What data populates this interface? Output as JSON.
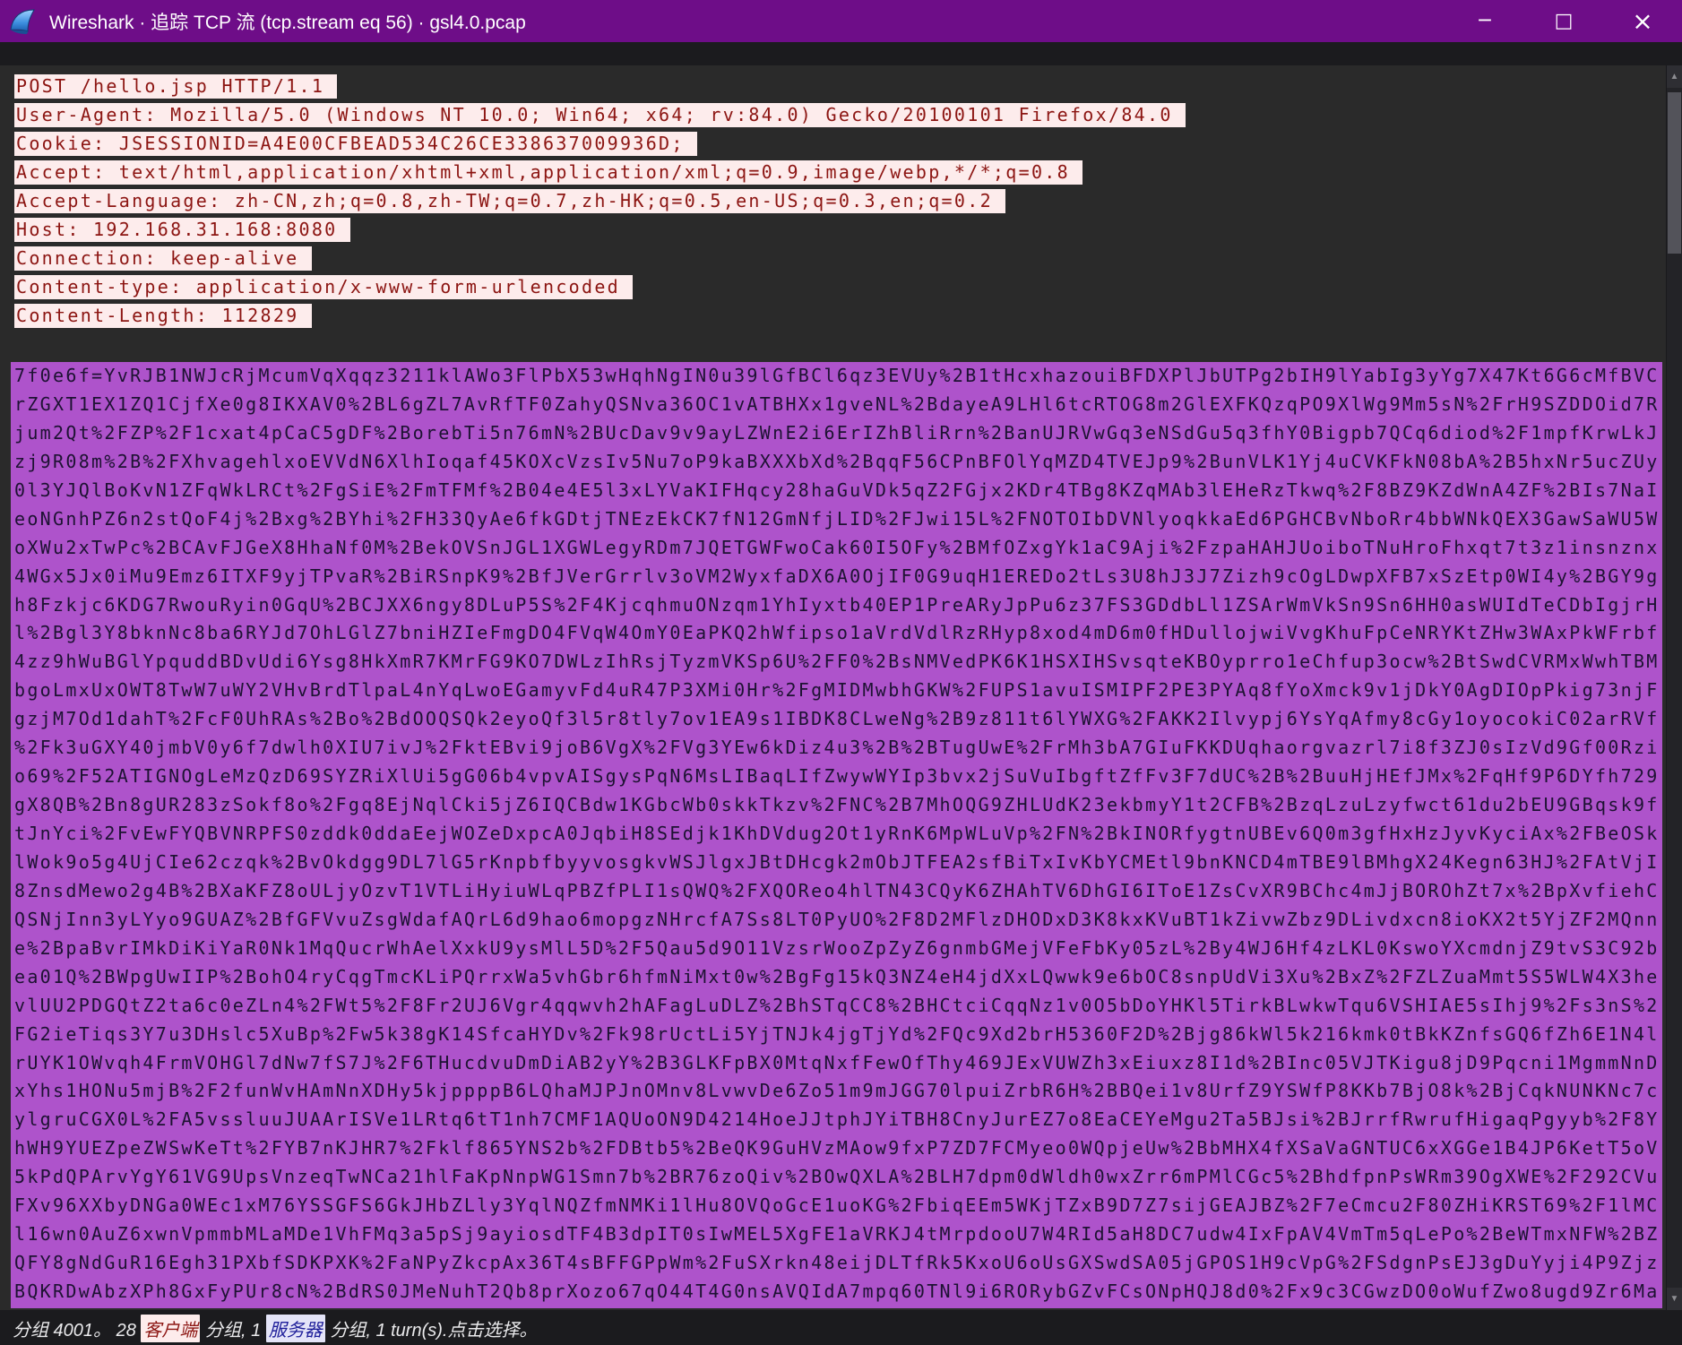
{
  "window": {
    "title": "Wireshark · 追踪 TCP 流 (tcp.stream eq 56) · gsl4.0.pcap",
    "minimize_glyph": "─",
    "maximize_glyph": "□",
    "close_glyph": "×"
  },
  "colors": {
    "titlebar": "#6e0d88",
    "pane_background": "#2a2a2a",
    "dialog_background": "#1b1b1e",
    "client_text": "#8c1512",
    "client_highlight": "#fdecec",
    "selection_highlight": "#ae53cb",
    "selection_text": "#1e1233",
    "server_badge_text": "#1d1d99",
    "server_badge_bg": "#e4e4f8"
  },
  "scrollbar": {
    "up_glyph": "▲",
    "down_glyph": "▼"
  },
  "stream": {
    "request_header_lines": [
      "POST /hello.jsp HTTP/1.1",
      "User-Agent: Mozilla/5.0 (Windows NT 10.0; Win64; x64; rv:84.0) Gecko/20100101 Firefox/84.0",
      "Cookie: JSESSIONID=A4E00CFBEAD534C26CE338637009936D;",
      "Accept: text/html,application/xhtml+xml,application/xml;q=0.9,image/webp,*/*;q=0.8",
      "Accept-Language: zh-CN,zh;q=0.8,zh-TW;q=0.7,zh-HK;q=0.5,en-US;q=0.3,en;q=0.2",
      "Host: 192.168.31.168:8080",
      "Connection: keep-alive",
      "Content-type: application/x-www-form-urlencoded",
      "Content-Length: 112829"
    ],
    "body_lines": [
      "7f0e6f=YvRJB1NWJcRjMcumVqXqqz3211klAWo3FlPbX53wHqhNgIN0u39lGfBCl6qz3EVUy%2B1tHcxhazouiBFDXPlJbUTPg2bIH9lYabIg3yYg7X47Kt6G6cMfBVC",
      "rZGXT1EX1ZQ1CjfXe0g8IKXAV0%2BL6gZL7AvRfTF0ZahyQSNva36OC1vATBHXx1gveNL%2BdayeA9LHl6tcRTOG8m2GlEXFKQzqPO9XlWg9Mm5sN%2FrH9SZDDOid7R",
      "jum2Qt%2FZP%2F1cxat4pCaC5gDF%2BorebTi5n76mN%2BUcDav9v9ayLZWnE2i6ErIZhBliRrn%2BanUJRVwGq3eNSdGu5q3fhY0Bigpb7QCq6diod%2F1mpfKrwLkJ",
      "zj9R08m%2B%2FXhvagehlxoEVVdN6XlhIoqaf45KOXcVzsIv5Nu7oP9kaBXXXbXd%2BqqF56CPnBFOlYqMZD4TVEJp9%2BunVLK1Yj4uCVKFkN08bA%2B5hxNr5ucZUy",
      "0l3YJQlBoKvN1ZFqWkLRCt%2FgSiE%2FmTFMf%2B04e4E5l3xLYVaKIFHqcy28haGuVDk5qZ2FGjx2KDr4TBg8KZqMAb3lEHeRzTkwq%2F8BZ9KZdWnA4ZF%2BIs7NaI",
      "eoNGnhPZ6n2stQoF4j%2Bxg%2BYhi%2FH33QyAe6fkGDtjTNEzEkCK7fN12GmNfjLID%2FJwi15L%2FNOTOIbDVNlyoqkkaEd6PGHCBvNboRr4bbWNkQEX3GawSaWU5W",
      "oXWu2xTwPc%2BCAvFJGeX8HhaNf0M%2BekOVSnJGL1XGWLegyRDm7JQETGWFwoCak60I5OFy%2BMfOZxgYk1aC9Aji%2FzpaHAHJUoiboTNuHroFhxqt7t3z1insnznx",
      "4WGx5Jx0iMu9Emz6ITXF9yjTPvaR%2BiRSnpK9%2BfJVerGrrlv3oVM2WyxfaDX6A0OjIF0G9uqH1EREDo2tLs3U8hJ3J7Zizh9cOgLDwpXFB7xSzEtp0WI4y%2BGY9g",
      "h8Fzkjc6KDG7RwouRyin0GqU%2BCJXX6ngy8DLuP5S%2F4KjcqhmuONzqm1YhIyxtb40EP1PreARyJpPu6z37FS3GDdbLl1ZSArWmVkSn9Sn6HH0asWUIdTeCDbIgjrH",
      "l%2Bgl3Y8bknNc8ba6RYJd7OhLGlZ7bniHZIeFmgDO4FVqW4OmY0EaPKQ2hWfipso1aVrdVdlRzRHyp8xod4mD6m0fHDullojwiVvgKhuFpCeNRYKtZHw3WAxPkWFrbf",
      "4zz9hWuBGlYpquddBDvUdi6Ysg8HkXmR7KMrFG9KO7DWLzIhRsjTyzmVKSp6U%2FF0%2BsNMVedPK6K1HSXIHSvsqteKBOyprro1eChfup3ocw%2BtSwdCVRMxWwhTBM",
      "bgoLmxUxOWT8TwW7uWY2VHvBrdTlpaL4nYqLwoEGamyvFd4uR47P3XMi0Hr%2FgMIDMwbhGKW%2FUPS1avuISMIPF2PE3PYAq8fYoXmck9v1jDkY0AgDIOpPkig73njF",
      "gzjM7Od1dahT%2FcF0UhRAs%2Bo%2BdOOQSQk2eyoQf3l5r8tly7ov1EA9s1IBDK8CLweNg%2B9z811t6lYWXG%2FAKK2Ilvypj6YsYqAfmy8cGy1oyocokiC02arRVf",
      "%2Fk3uGXY40jmbV0y6f7dwlh0XIU7ivJ%2FktEBvi9joB6VgX%2FVg3YEw6kDiz4u3%2B%2BTugUwE%2FrMh3bA7GIuFKKDUqhaorgvazrl7i8f3ZJ0sIzVd9Gf00Rzi",
      "o69%2F52ATIGNOgLeMzQzD69SYZRiXlUi5gG06b4vpvAISgysPqN6MsLIBaqLIfZwywWYIp3bvx2jSuVuIbgftZfFv3F7dUC%2B%2BuuHjHEfJMx%2FqHf9P6DYfh729",
      "gX8QB%2Bn8gUR283zSokf8o%2Fgq8EjNqlCki5jZ6IQCBdw1KGbcWb0skkTkzv%2FNC%2B7MhOQG9ZHLUdK23ekbmyY1t2CFB%2BzqLzuLzyfwct61du2bEU9GBqsk9f",
      "tJnYci%2FvEwFYQBVNRPFS0zddk0ddaEejWOZeDxpcA0JqbiH8SEdjk1KhDVdug2Ot1yRnK6MpWLuVp%2FN%2BkINORfygtnUBEv6Q0m3gfHxHzJyvKyciAx%2FBeOSk",
      "lWok9o5g4UjCIe62czqk%2BvOkdgg9DL7lG5rKnpbfbyyvosgkvWSJlgxJBtDHcgk2mObJTFEA2sfBiTxIvKbYCMEtl9bnKNCD4mTBE9lBMhgX24Kegn63HJ%2FAtVjI",
      "8ZnsdMewo2g4B%2BXaKFZ8oULjyOzvT1VTLiHyiuWLqPBZfPLI1sQWQ%2FXQOReo4hlTN43CQyK6ZHAhTV6DhGI6IToE1ZsCvXR9BChc4mJjBOROhZt7x%2BpXvfiehC",
      "QSNjInn3yLYyo9GUAZ%2BfGFVvuZsgWdafAQrL6d9hao6mopgzNHrcfA7Ss8LT0PyUO%2F8D2MFlzDHODxD3K8kxKVuBT1kZivwZbz9DLivdxcn8ioKX2t5YjZF2MQnn",
      "e%2BpaBvrIMkDiKiYaR0Nk1MqQucrWhAelXxkU9ysMlL5D%2F5Qau5d9O11VzsrWooZpZyZ6gnmbGMejVFeFbKy05zL%2By4WJ6Hf4zLKL0KswoYXcmdnjZ9tvS3C92b",
      "ea01Q%2BWpgUwIIP%2BohO4ryCqgTmcKLiPQrrxWa5vhGbr6hfmNiMxt0w%2BgFg15kQ3NZ4eH4jdXxLQwwk9e6bOC8snpUdVi3Xu%2BxZ%2FZLZuaMmt5S5WLW4X3he",
      "vlUU2PDGQtZ2ta6c0eZLn4%2FWt5%2F8Fr2UJ6Vgr4qqwvh2hAFagLuDLZ%2BhSTqCC8%2BHCtciCqqNz1v0O5bDoYHKl5TirkBLwkwTqu6VSHIAE5sIhj9%2Fs3nS%2",
      "FG2ieTiqs3Y7u3DHslc5XuBp%2Fw5k38gK14SfcaHYDv%2Fk98rUctLi5YjTNJk4jgTjYd%2FQc9Xd2brH5360F2D%2Bjg86kWl5k216kmk0tBkKZnfsGQ6fZh6E1N4l",
      "rUYK1OWvqh4FrmVOHGl7dNw7fS7J%2F6THucdvuDmDiAB2yY%2B3GLKFpBX0MtqNxfFewOfThy469JExVUWZh3xEiuxz8I1d%2BInc05VJTKigu8jD9Pqcni1MgmmNnD",
      "xYhs1HONu5mjB%2F2funWvHAmNnXDHy5kjppppB6LQhaMJPJnOMnv8LvwvDe6Zo51m9mJGG70lpuiZrbR6H%2BBQei1v8UrfZ9YSWfP8KKb7BjO8k%2BjCqkNUNKNc7c",
      "ylgruCGX0L%2FA5vssluuJUAArISVe1LRtq6tT1nh7CMF1AQUoON9D4214HoeJJtphJYiTBH8CnyJurEZ7o8EaCEYeMgu2Ta5BJsi%2BJrrfRwrufHigaqPgyyb%2F8Y",
      "hWH9YUEZpeZWSwKeTt%2FYB7nKJHR7%2Fklf865YNS2b%2FDBtb5%2BeQK9GuHVzMAow9fxP7ZD7FCMyeo0WQpjeUw%2BbMHX4fXSaVaGNTUC6xXGGe1B4JP6KetT5oV",
      "5kPdQPArvYgY61VG9UpsVnzeqTwNCa21hlFaKpNnpWG1Smn7b%2BR76zoQiv%2BOwQXLA%2BLH7dpm0dWldh0wxZrr6mPMlCGc5%2BhdfpnPsWRm39OgXWE%2F292CVu",
      "FXv96XXbyDNGa0WEc1xM76YSSGFS6GkJHbZLly3YqlNQZfmNMKi1lHu8OVQoGcE1uoKG%2FbiqEEm5WKjTZxB9D7Z7sijGEAJBZ%2F7eCmcu2F80ZHiKRST69%2F1lMC",
      "l16wn0AuZ6xwnVpmmbMLaMDe1VhFMq3a5pSj9ayiosdTF4B3dpIT0sIwMEL5XgFE1aVRKJ4tMrpdooU7W4RId5aH8DC7udw4IxFpAV4VmTm5qLePo%2BeWTmxNFW%2BZ",
      "QFY8gNdGuR16Egh31PXbfSDKPXK%2FaNPyZkcpAx36T4sBFFGPpWm%2FuSXrkn48eijDLTfRk5KxoU6oUsGXSwdSA05jGPOS1H9cVpG%2FSdgnPsEJ3gDuYyji4P9Zjz",
      "BQKRDwAbzXPh8GxFyPUr8cN%2BdRS0JMeNuhT2Qb8prXozo67qO44T4G0nsAVQIdA7mpq60TNl9i6RORybGZvFCsONpHQJ8d0%2Fx9c3CGwzDO0oWufZwo8ugd9Zr6Ma"
    ]
  },
  "status": {
    "part1": "分组 4001。 28 ",
    "client_label": "客户端",
    "part2": " 分组, 1 ",
    "server_label": "服务器",
    "part3": " 分组, 1 turn(s).点击选择。"
  }
}
